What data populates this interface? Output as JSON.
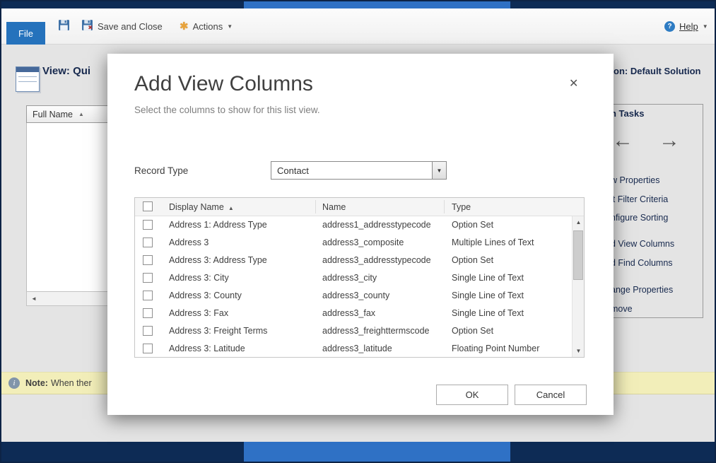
{
  "colors": {
    "navy": "#0d2b55",
    "accent_blue": "#2572bc",
    "note_bg": "#f2eeb9"
  },
  "icons": {
    "sort_asc": "▲",
    "caret_down": "▼",
    "back_arrow": "←",
    "forward_arrow": "→",
    "close": "✕",
    "scroll_left": "◄",
    "scroll_up": "▲",
    "scroll_down": "▼",
    "actions_star": "✱",
    "help_q": "?",
    "info_i": "i"
  },
  "toolbar": {
    "file_label": "File",
    "save_and_close_label": "Save and Close",
    "actions_label": "Actions",
    "help_label": "Help"
  },
  "page": {
    "title_partial": "View: Qui",
    "solution_partial": "on: Default Solution",
    "grid_column_header": "Full Name",
    "tasks": {
      "title_partial": "n Tasks",
      "links": [
        "w Properties",
        "it Filter Criteria",
        "nfigure Sorting",
        "d View Columns",
        "d Find Columns",
        "ange Properties",
        "move"
      ]
    },
    "note_bold": "Note:",
    "note_text": "When ther"
  },
  "dialog": {
    "title": "Add View Columns",
    "subtitle": "Select the columns to show for this list view.",
    "record_type": {
      "label": "Record Type",
      "value": "Contact"
    },
    "table": {
      "headers": {
        "display_name": "Display Name",
        "name": "Name",
        "type": "Type"
      },
      "rows": [
        {
          "display_name": "Address 1: Address Type",
          "name": "address1_addresstypecode",
          "type": "Option Set"
        },
        {
          "display_name": "Address 3",
          "name": "address3_composite",
          "type": "Multiple Lines of Text"
        },
        {
          "display_name": "Address 3: Address Type",
          "name": "address3_addresstypecode",
          "type": "Option Set"
        },
        {
          "display_name": "Address 3: City",
          "name": "address3_city",
          "type": "Single Line of Text"
        },
        {
          "display_name": "Address 3: County",
          "name": "address3_county",
          "type": "Single Line of Text"
        },
        {
          "display_name": "Address 3: Fax",
          "name": "address3_fax",
          "type": "Single Line of Text"
        },
        {
          "display_name": "Address 3: Freight Terms",
          "name": "address3_freighttermscode",
          "type": "Option Set"
        },
        {
          "display_name": "Address 3: Latitude",
          "name": "address3_latitude",
          "type": "Floating Point Number"
        }
      ]
    },
    "buttons": {
      "ok": "OK",
      "cancel": "Cancel"
    }
  }
}
